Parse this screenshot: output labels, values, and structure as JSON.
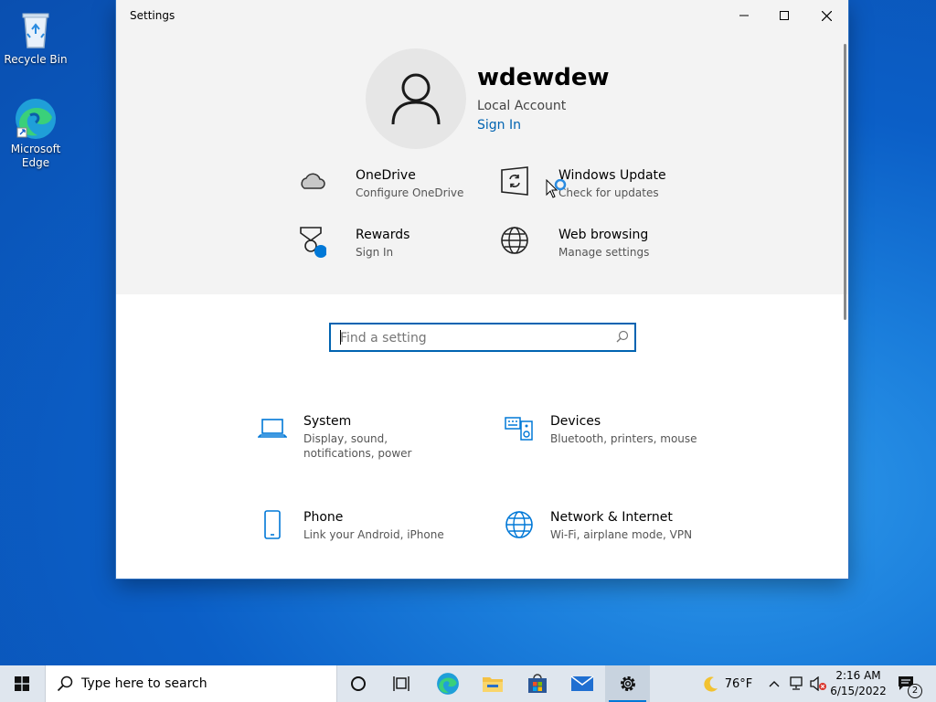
{
  "desktop": {
    "icons": [
      {
        "label": "Recycle Bin",
        "icon": "recycle-bin-icon"
      },
      {
        "label": "Microsoft Edge",
        "icon": "edge-icon"
      }
    ]
  },
  "window": {
    "title": "Settings",
    "buttons": {
      "minimize": "minimize-icon",
      "maximize": "maximize-icon",
      "close": "close-icon"
    }
  },
  "account": {
    "username": "wdewdew",
    "type": "Local Account",
    "sign_in": "Sign In"
  },
  "quick_links": [
    {
      "title": "OneDrive",
      "subtitle": "Configure OneDrive",
      "icon": "cloud-icon"
    },
    {
      "title": "Windows Update",
      "subtitle": "Check for updates",
      "icon": "refresh-icon"
    },
    {
      "title": "Rewards",
      "subtitle": "Sign In",
      "icon": "trophy-icon"
    },
    {
      "title": "Web browsing",
      "subtitle": "Manage settings",
      "icon": "globe-icon"
    }
  ],
  "search": {
    "placeholder": "Find a setting"
  },
  "categories": [
    {
      "title": "System",
      "subtitle": "Display, sound, notifications, power",
      "icon": "laptop-icon"
    },
    {
      "title": "Devices",
      "subtitle": "Bluetooth, printers, mouse",
      "icon": "keyboard-speaker-icon"
    },
    {
      "title": "Phone",
      "subtitle": "Link your Android, iPhone",
      "icon": "phone-icon"
    },
    {
      "title": "Network & Internet",
      "subtitle": "Wi-Fi, airplane mode, VPN",
      "icon": "globe-icon"
    }
  ],
  "taskbar": {
    "search_text": "Type here to search",
    "weather": "76°F",
    "time": "2:16 AM",
    "date": "6/15/2022",
    "notification_count": "2"
  },
  "colors": {
    "accent": "#0063b1",
    "header_bg": "#f3f3f3",
    "taskbar_bg": "#dfe6ee"
  }
}
